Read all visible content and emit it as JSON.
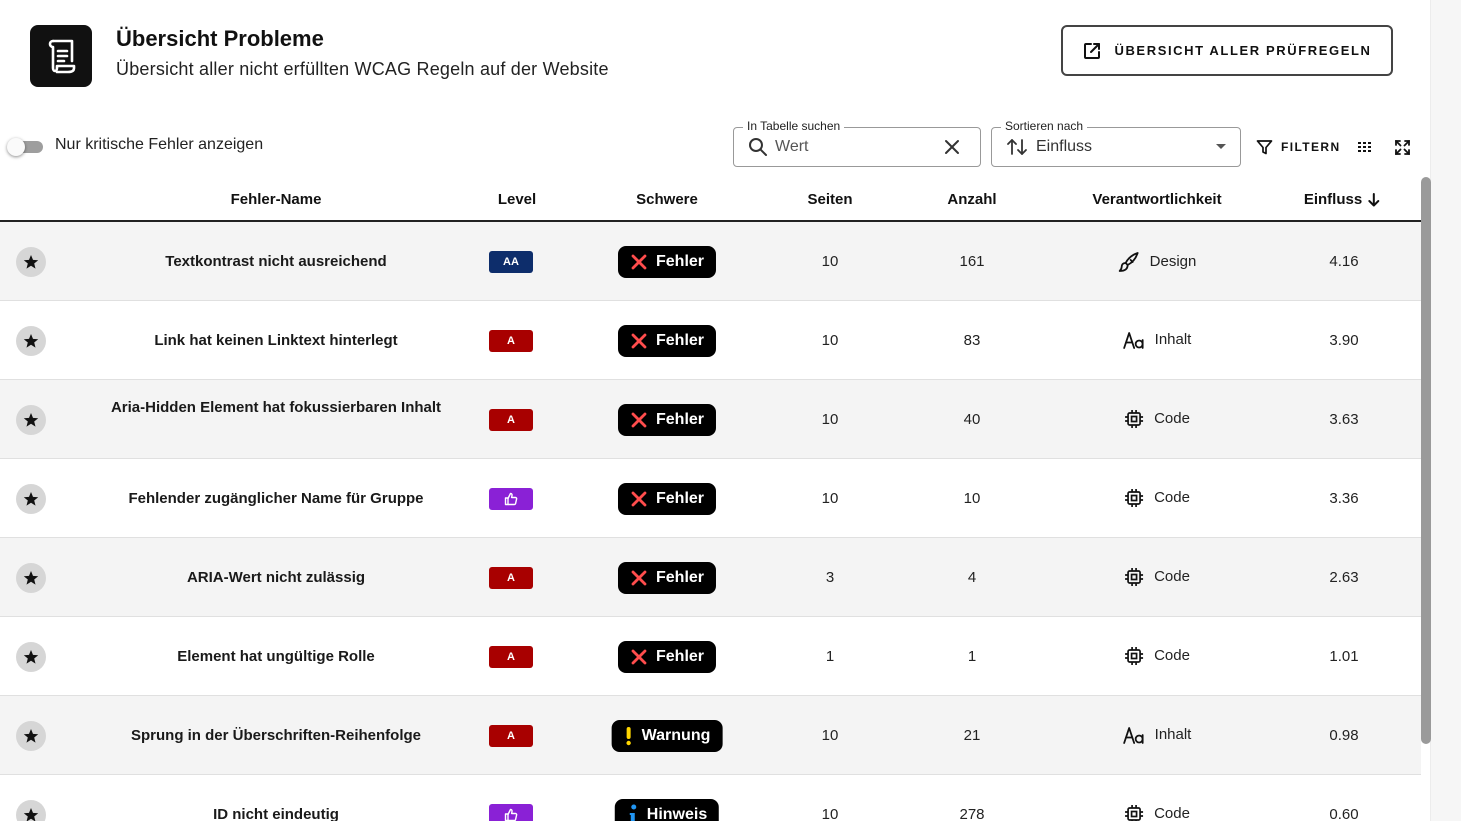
{
  "header": {
    "title": "Übersicht Probleme",
    "subtitle": "Übersicht aller nicht erfüllten WCAG Regeln auf der Website",
    "rules_button_label": "ÜBERSICHT ALLER PRÜFREGELN"
  },
  "toolbar": {
    "toggle_label": "Nur kritische Fehler anzeigen",
    "toggle_on": false,
    "search": {
      "legend": "In Tabelle suchen",
      "value": "Wert"
    },
    "sort": {
      "legend": "Sortieren nach",
      "value": "Einfluss"
    },
    "filter_label": "FILTERN"
  },
  "columns": [
    "Fehler-Name",
    "Level",
    "Schwere",
    "Seiten",
    "Anzahl",
    "Verantwortlichkeit",
    "Einfluss"
  ],
  "rows": [
    {
      "name": "Textkontrast nicht ausreichend",
      "level": "AA",
      "level_type": "aa",
      "severity": "Fehler",
      "severity_icon": "x-icon",
      "pages": "10",
      "count": "161",
      "responsibility": "Design",
      "resp_icon": "brush-icon",
      "impact": "4.16"
    },
    {
      "name": "Link hat keinen Linktext hinterlegt",
      "level": "A",
      "level_type": "a",
      "severity": "Fehler",
      "severity_icon": "x-icon",
      "pages": "10",
      "count": "83",
      "responsibility": "Inhalt",
      "resp_icon": "text-icon",
      "impact": "3.90"
    },
    {
      "name": "Aria-Hidden Element hat fokussierbaren Inhalt",
      "level": "A",
      "level_type": "a",
      "severity": "Fehler",
      "severity_icon": "x-icon",
      "pages": "10",
      "count": "40",
      "responsibility": "Code",
      "resp_icon": "chip-icon",
      "impact": "3.63"
    },
    {
      "name": "Fehlender zugänglicher Name für Gruppe",
      "level": "",
      "level_type": "best",
      "severity": "Fehler",
      "severity_icon": "x-icon",
      "pages": "10",
      "count": "10",
      "responsibility": "Code",
      "resp_icon": "chip-icon",
      "impact": "3.36"
    },
    {
      "name": "ARIA-Wert nicht zulässig",
      "level": "A",
      "level_type": "a",
      "severity": "Fehler",
      "severity_icon": "x-icon",
      "pages": "3",
      "count": "4",
      "responsibility": "Code",
      "resp_icon": "chip-icon",
      "impact": "2.63"
    },
    {
      "name": "Element hat ungültige Rolle",
      "level": "A",
      "level_type": "a",
      "severity": "Fehler",
      "severity_icon": "x-icon",
      "pages": "1",
      "count": "1",
      "responsibility": "Code",
      "resp_icon": "chip-icon",
      "impact": "1.01"
    },
    {
      "name": "Sprung in der Überschriften-Reihenfolge",
      "level": "A",
      "level_type": "a",
      "severity": "Warnung",
      "severity_icon": "exclamation-icon",
      "pages": "10",
      "count": "21",
      "responsibility": "Inhalt",
      "resp_icon": "text-icon",
      "impact": "0.98"
    },
    {
      "name": "ID nicht eindeutig",
      "level": "",
      "level_type": "best",
      "severity": "Hinweis",
      "severity_icon": "info-icon",
      "pages": "10",
      "count": "278",
      "responsibility": "Code",
      "resp_icon": "chip-icon",
      "impact": "0.60"
    }
  ],
  "colors": {
    "level_aa": "#0d2d6b",
    "level_a": "#a80000",
    "level_best_practice": "#8a21d6",
    "error_x": "#ff4d4d",
    "warning": "#ffd600",
    "info": "#2196f3"
  }
}
